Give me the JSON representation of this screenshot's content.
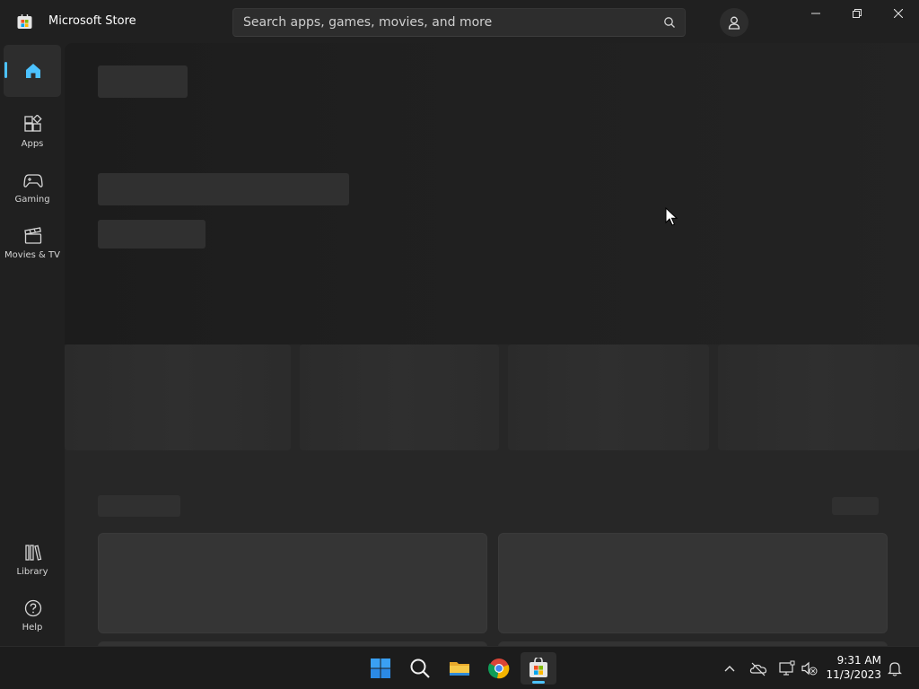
{
  "window": {
    "app_title": "Microsoft Store",
    "controls": [
      "minimize-icon",
      "restore-icon",
      "close-icon"
    ]
  },
  "search": {
    "placeholder": "Search apps, games, movies, and more",
    "icon": "search-icon"
  },
  "account": {
    "icon": "person-icon"
  },
  "sidebar": {
    "items": [
      {
        "label": "",
        "icon": "home-icon",
        "active": true
      },
      {
        "label": "Apps",
        "icon": "apps-icon"
      },
      {
        "label": "Gaming",
        "icon": "gamepad-icon"
      },
      {
        "label": "Movies & TV",
        "icon": "clapperboard-icon"
      }
    ],
    "bottom_items": [
      {
        "label": "Library",
        "icon": "library-icon"
      },
      {
        "label": "Help",
        "icon": "help-icon"
      }
    ]
  },
  "main": {
    "state": "loading"
  },
  "taskbar": {
    "apps": [
      "start-icon",
      "search-icon",
      "file-explorer-icon",
      "chrome-icon",
      "microsoft-store-icon"
    ],
    "tray": [
      "chevron-up-icon",
      "onedrive-icon",
      "network-icon",
      "volume-muted-icon",
      "notification-bell-icon"
    ],
    "time": "9:31 AM",
    "date": "11/3/2023"
  },
  "colors": {
    "accent": "#4cc2ff",
    "background": "#202020",
    "content": "#272727"
  }
}
